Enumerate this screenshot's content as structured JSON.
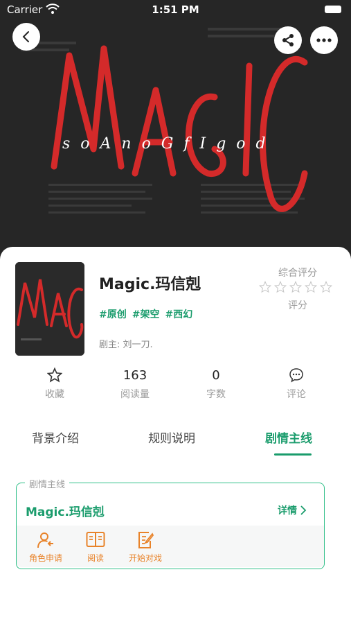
{
  "status_bar": {
    "carrier": "Carrier",
    "time": "1:51 PM"
  },
  "hero": {
    "art_text": "MAGIC",
    "art_subtext": "s o A n o G f I g o d",
    "accent_color": "#d42a2a"
  },
  "work": {
    "title": "Magic.玛信剋",
    "tags": [
      "#原创",
      "#架空",
      "#西幻"
    ],
    "author_label": "剧主:",
    "author_name": "刘一刀."
  },
  "rating": {
    "label": "综合评分",
    "sub_label": "评分",
    "stars": 0,
    "max_stars": 5
  },
  "stats": [
    {
      "value": "",
      "label": "收藏",
      "icon": "star-outline-icon"
    },
    {
      "value": "163",
      "label": "阅读量"
    },
    {
      "value": "0",
      "label": "字数"
    },
    {
      "value": "",
      "label": "评论",
      "icon": "comment-icon"
    }
  ],
  "tabs": [
    {
      "label": "背景介绍",
      "active": false
    },
    {
      "label": "规则说明",
      "active": false
    },
    {
      "label": "剧情主线",
      "active": true
    }
  ],
  "plot_section": {
    "legend": "剧情主线",
    "title": "Magic.玛信剋",
    "detail_label": "详情",
    "actions": [
      {
        "label": "角色申请",
        "icon": "role-apply-icon"
      },
      {
        "label": "阅读",
        "icon": "book-icon"
      },
      {
        "label": "开始对戏",
        "icon": "edit-icon"
      }
    ]
  },
  "colors": {
    "primary": "#1a9c6c",
    "action": "#e8832a"
  }
}
